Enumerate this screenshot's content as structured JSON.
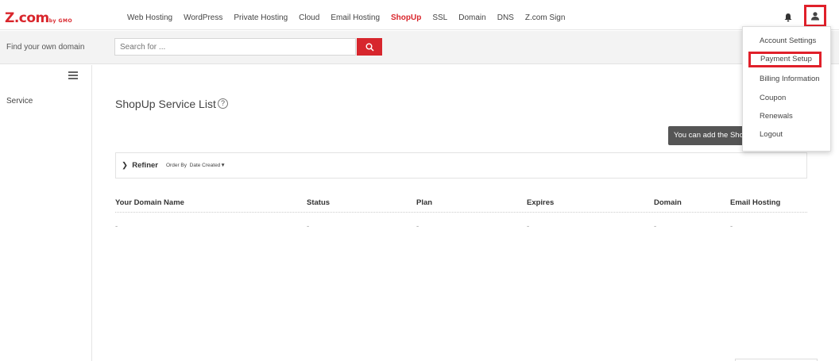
{
  "brand": {
    "logo": "Z.com",
    "logo_sub": "by GMO",
    "accent": "#d9262c"
  },
  "nav": {
    "items": [
      "Web Hosting",
      "WordPress",
      "Private Hosting",
      "Cloud",
      "Email Hosting",
      "ShopUp",
      "SSL",
      "Domain",
      "DNS",
      "Z.com Sign"
    ],
    "active": "ShopUp"
  },
  "icons": {
    "bell": "bell-icon",
    "user": "user-icon",
    "search": "search-icon",
    "menu": "hamburger-icon",
    "help": "help-icon"
  },
  "search": {
    "label": "Find your own domain",
    "placeholder": "Search for ..."
  },
  "sidebar": {
    "service": "Service"
  },
  "main": {
    "title": "ShopUp Service List",
    "help_glyph": "?",
    "tooltip": "You can add the ShopUp",
    "refiner": {
      "label": "Refiner",
      "order_by_label": "Order By",
      "order_by_value": "Date Created"
    },
    "table": {
      "columns": [
        "Your Domain Name",
        "Status",
        "Plan",
        "Expires",
        "Domain",
        "Email Hosting"
      ],
      "rows": [
        [
          "-",
          "-",
          "-",
          "-",
          "-",
          "-"
        ]
      ]
    }
  },
  "user_menu": {
    "items": [
      "Account Settings",
      "Payment Setup",
      "Billing Information",
      "Coupon",
      "Renewals",
      "Logout"
    ],
    "highlighted": "Payment Setup",
    "highlight_color": "#e0202a"
  }
}
